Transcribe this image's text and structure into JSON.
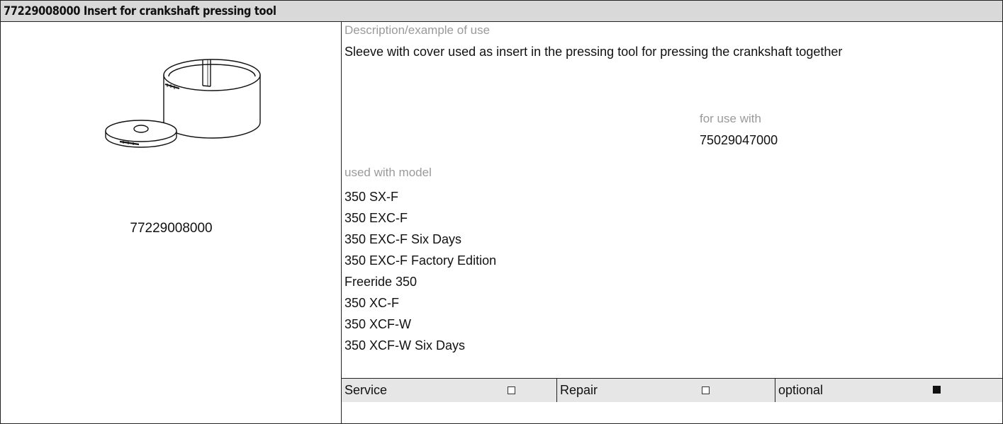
{
  "header": {
    "title": "77229008000 Insert for crankshaft pressing tool"
  },
  "illustration": {
    "icon": "insert-sleeve-and-cover-drawing",
    "caption": "77229008000"
  },
  "description": {
    "label": "Description/example of use",
    "text": "Sleeve with cover used as insert in the pressing tool for pressing the crankshaft together"
  },
  "for_use_with": {
    "label": "for use with",
    "value": "75029047000"
  },
  "models": {
    "label": "used with model",
    "items": [
      "350 SX-F",
      "350 EXC-F",
      "350 EXC-F Six Days",
      "350 EXC-F Factory Edition",
      "Freeride 350",
      "350 XC-F",
      "350 XCF-W",
      "350 XCF-W Six Days"
    ]
  },
  "categories": [
    {
      "label": "Service",
      "checked": false
    },
    {
      "label": "Repair",
      "checked": false
    },
    {
      "label": "optional",
      "checked": true
    }
  ]
}
